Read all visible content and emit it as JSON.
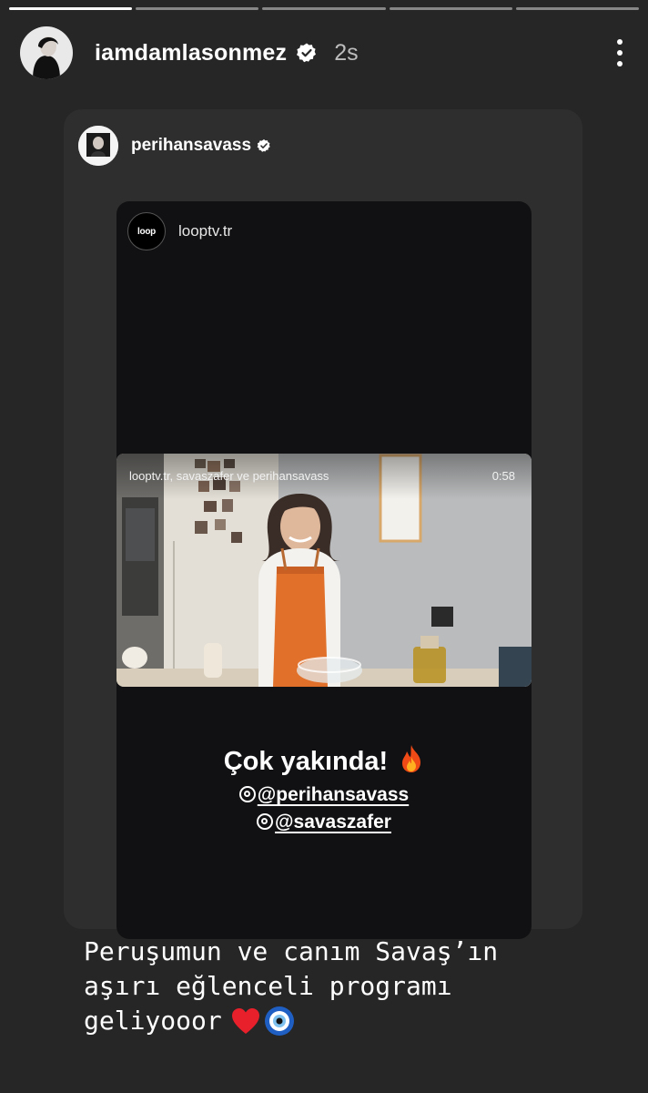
{
  "story": {
    "progress_segments": 5,
    "completed_segments": 1,
    "username": "iamdamlasonmez",
    "time": "2s"
  },
  "shared_post": {
    "username": "perihansavass",
    "inner_story": {
      "username": "looptv.tr",
      "logo_text": "loop",
      "video": {
        "caption": "looptv.tr, savaszafer ve perihansavass",
        "duration": "0:58"
      },
      "headline": "Çok yakında!",
      "mentions": [
        "@perihansavass",
        "@savaszafer"
      ]
    }
  },
  "caption": {
    "text": "Peruşumun ve canım Savaş’ın\naşırı eğlenceli programı\ngeliyooor"
  },
  "colors": {
    "background": "#262626",
    "verified_badge": "#ffffff",
    "apron": "#e0702a"
  }
}
